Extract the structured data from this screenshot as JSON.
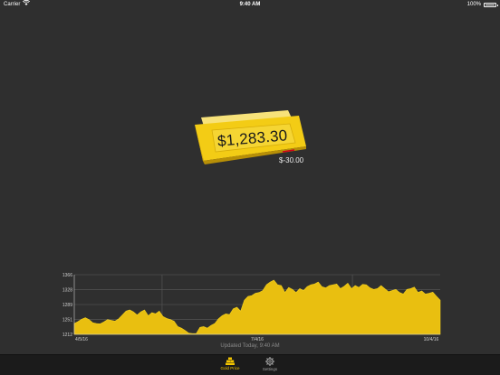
{
  "status_bar": {
    "carrier": "Carrier",
    "time": "9:40 AM",
    "battery": "100%",
    "battery_fraction": 1.0
  },
  "hero": {
    "price": "$1,283.30",
    "change": "$-30.00"
  },
  "chart_data": {
    "type": "area",
    "title": "",
    "xlabel": "",
    "ylabel": "",
    "x_tick_labels": [
      "4/5/16",
      "7/4/16",
      "10/4/16"
    ],
    "y_tick_labels": [
      "1366",
      "1328",
      "1289",
      "1251",
      "1212"
    ],
    "ylim": [
      1212,
      1366
    ],
    "grid": true,
    "series": [
      {
        "values": [
          1240,
          1245,
          1251,
          1255,
          1250,
          1242,
          1240,
          1239,
          1244,
          1250,
          1248,
          1246,
          1252,
          1262,
          1272,
          1275,
          1270,
          1262,
          1270,
          1275,
          1260,
          1268,
          1265,
          1272,
          1258,
          1253,
          1250,
          1246,
          1232,
          1228,
          1222,
          1215,
          1214,
          1214,
          1230,
          1232,
          1228,
          1235,
          1240,
          1252,
          1260,
          1265,
          1263,
          1278,
          1282,
          1272,
          1300,
          1310,
          1312,
          1318,
          1320,
          1325,
          1340,
          1347,
          1352,
          1340,
          1338,
          1320,
          1333,
          1328,
          1320,
          1330,
          1325,
          1335,
          1340,
          1342,
          1347,
          1335,
          1332,
          1338,
          1340,
          1342,
          1330,
          1336,
          1344,
          1330,
          1338,
          1333,
          1341,
          1340,
          1332,
          1328,
          1330,
          1338,
          1330,
          1322,
          1325,
          1328,
          1320,
          1316,
          1328,
          1330,
          1334,
          1320,
          1324,
          1316,
          1318,
          1321,
          1310,
          1300
        ]
      }
    ]
  },
  "footer": {
    "updated": "Updated Today, 9:40 AM"
  },
  "tabs": [
    {
      "label": "Gold Price",
      "icon": "gold-bars-icon",
      "active": true
    },
    {
      "label": "Settings",
      "icon": "gear-icon",
      "active": false
    }
  ],
  "colors": {
    "background": "#2f2f2f",
    "gold": "#f2c400",
    "area_fill": "#e9bf10",
    "negative": "#d0021b"
  }
}
